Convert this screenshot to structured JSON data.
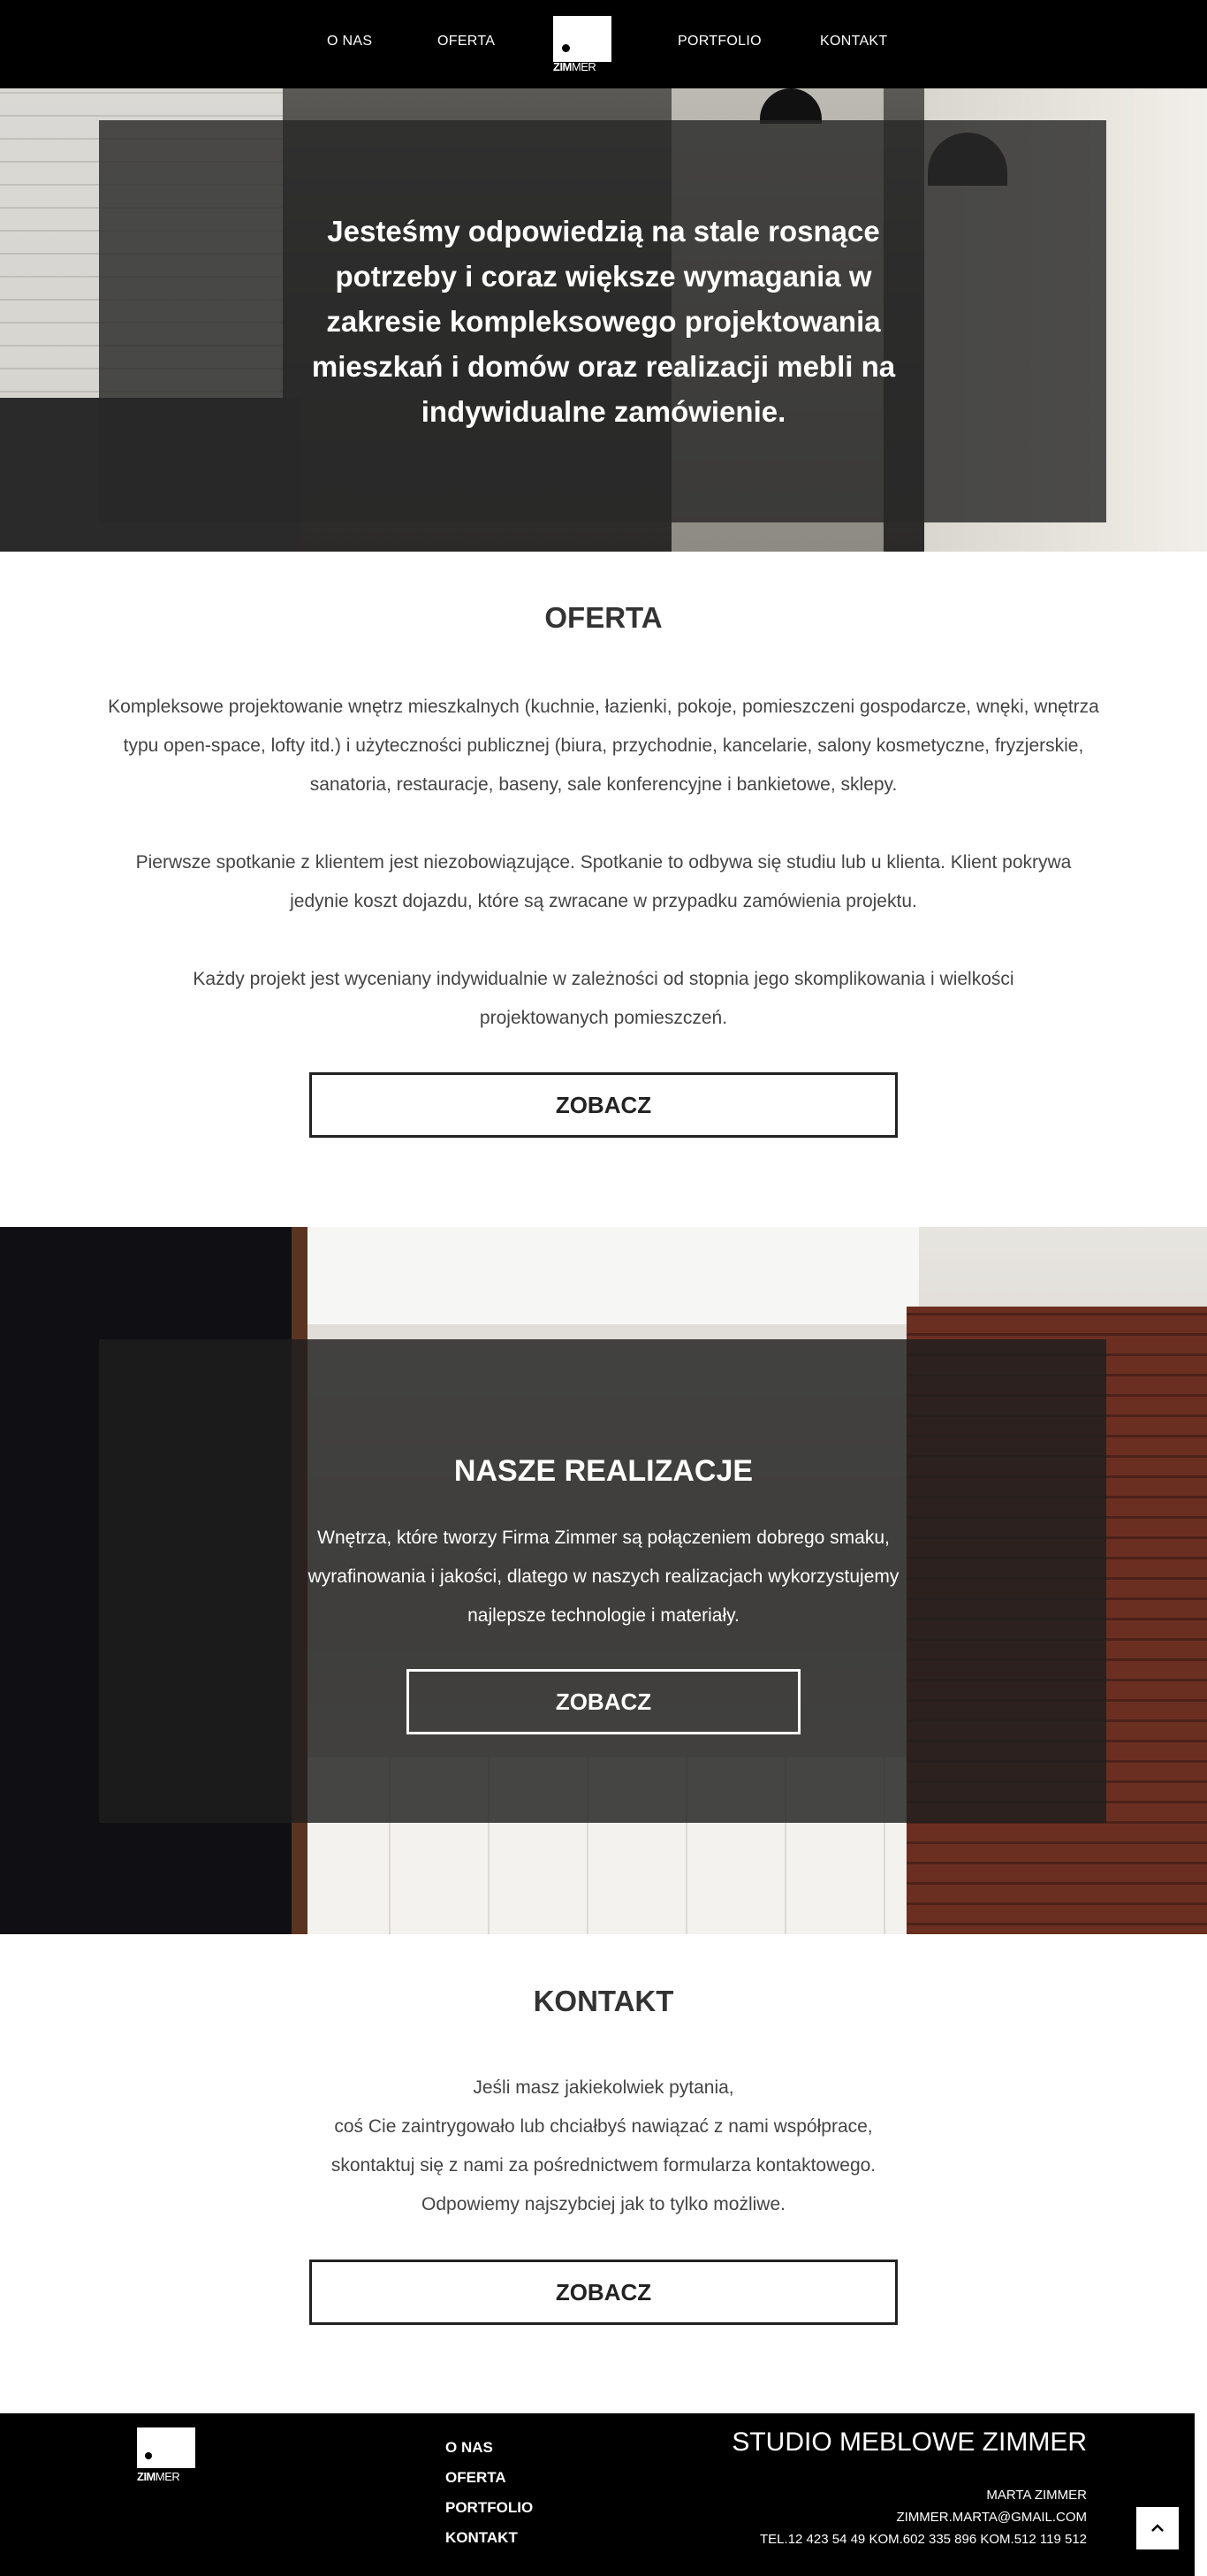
{
  "nav": {
    "items": [
      "O NAS",
      "OFERTA",
      "PORTFOLIO",
      "KONTAKT"
    ],
    "logo_text_bold": "ZIM",
    "logo_text_light": "MER"
  },
  "hero": {
    "text": "Jesteśmy odpowiedzią na stale rosnące potrzeby i coraz większe wymagania w zakresie kompleksowego projektowania mieszkań i domów oraz realizacji mebli na indywidualne zamówienie."
  },
  "oferta": {
    "title": "OFERTA",
    "paragraphs": [
      "Kompleksowe projektowanie wnętrz mieszkalnych (kuchnie, łazienki, pokoje, pomieszczeni gospodarcze, wnęki, wnętrza typu open-space, lofty itd.) i użyteczności publicznej (biura, przychodnie, kancelarie, salony kosmetyczne, fryzjerskie, sanatoria, restauracje, baseny, sale konferencyjne i bankietowe, sklepy.",
      "Pierwsze spotkanie z klientem jest niezobowiązujące. Spotkanie to odbywa się studiu lub u klienta. Klient pokrywa jedynie koszt dojazdu, które są zwracane w przypadku zamówienia projektu.",
      "Każdy projekt jest wyceniany indywidualnie w zależności od stopnia jego skomplikowania i wielkości projektowanych pomieszczeń."
    ],
    "button": "ZOBACZ"
  },
  "realizacje": {
    "title": "NASZE REALIZACJE",
    "text": "Wnętrza, które tworzy Firma Zimmer są połączeniem dobrego smaku, wyrafinowania i jakości, dlatego w naszych realizacjach wykorzystujemy najlepsze technologie i materiały.",
    "button": "ZOBACZ"
  },
  "kontakt": {
    "title": "KONTAKT",
    "lines": [
      "Jeśli masz jakiekolwiek pytania,",
      "coś Cie zaintrygowało lub chciałbyś nawiązać z nami współprace,",
      "skontaktuj się z nami za pośrednictwem formularza kontaktowego.",
      "Odpowiemy najszybciej jak to tylko możliwe."
    ],
    "button": "ZOBACZ"
  },
  "footer": {
    "links": [
      "O NAS",
      "OFERTA",
      "PORTFOLIO",
      "KONTAKT"
    ],
    "title": "STUDIO MEBLOWE ZIMMER",
    "name": "MARTA ZIMMER",
    "email": "ZIMMER.MARTA@GMAIL.COM",
    "phones": "TEL.12 423 54 49 KOM.602 335 896 KOM.512 119 512",
    "logo_text_bold": "ZIM",
    "logo_text_light": "MER"
  },
  "icons": {
    "to_top": "chevron-up-icon"
  }
}
